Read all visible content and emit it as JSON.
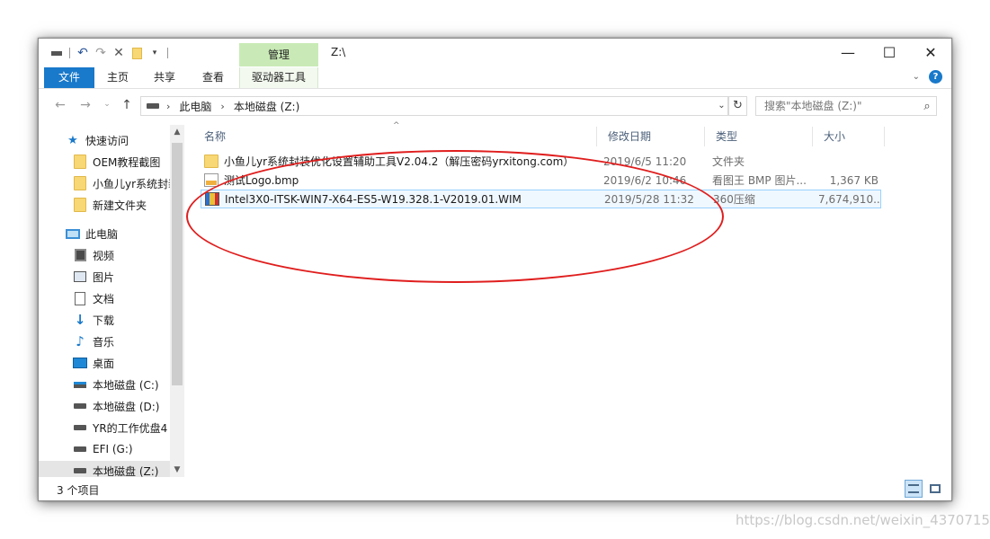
{
  "window": {
    "title": "Z:\\",
    "context_tab": "管理",
    "caption": {
      "minimize": "—",
      "maximize": "☐",
      "close": "✕"
    }
  },
  "ribbon": {
    "file": "文件",
    "home": "主页",
    "share": "共享",
    "view": "查看",
    "drive_tools": "驱动器工具",
    "help": "?"
  },
  "address": {
    "crumbs": [
      "此电脑",
      "本地磁盘 (Z:)"
    ],
    "search_placeholder": "搜索\"本地磁盘 (Z:)\""
  },
  "nav": {
    "quick_access": "快速访问",
    "pinned": [
      "OEM教程截图",
      "小鱼儿yr系统封装",
      "新建文件夹"
    ],
    "this_pc": "此电脑",
    "pc_items": [
      {
        "label": "视频",
        "icon": "video-icon"
      },
      {
        "label": "图片",
        "icon": "pictures-icon"
      },
      {
        "label": "文档",
        "icon": "document-icon"
      },
      {
        "label": "下载",
        "icon": "download-icon"
      },
      {
        "label": "音乐",
        "icon": "music-icon"
      },
      {
        "label": "桌面",
        "icon": "desktop-icon"
      },
      {
        "label": "本地磁盘 (C:)",
        "icon": "system-drive-icon"
      },
      {
        "label": "本地磁盘 (D:)",
        "icon": "drive-icon"
      },
      {
        "label": "YR的工作优盘4",
        "icon": "drive-icon"
      },
      {
        "label": "EFI (G:)",
        "icon": "drive-icon"
      },
      {
        "label": "本地磁盘 (Z:)",
        "icon": "drive-icon"
      }
    ]
  },
  "columns": {
    "name": "名称",
    "date": "修改日期",
    "type": "类型",
    "size": "大小"
  },
  "files": [
    {
      "name": "小鱼儿yr系统封装优化设置辅助工具V2.04.2（解压密码yrxitong.com）",
      "date": "2019/6/5 11:20",
      "type": "文件夹",
      "size": "",
      "icon": "folder-icon"
    },
    {
      "name": "测试Logo.bmp",
      "date": "2019/6/2 10:46",
      "type": "看图王 BMP 图片...",
      "size": "1,367 KB",
      "icon": "bmp-file-icon"
    },
    {
      "name": "Intel3X0-ITSK-WIN7-X64-ES5-W19.328.1-V2019.01.WIM",
      "date": "2019/5/28 11:32",
      "type": "360压缩",
      "size": "7,674,910...",
      "icon": "archive-file-icon"
    }
  ],
  "status": {
    "count": "3 个项目"
  },
  "watermark": "https://blog.csdn.net/weixin_43707156",
  "colors": {
    "accent": "#1979ca",
    "context_tab": "#c9eab6",
    "annotation": "#e01e1e",
    "selection": "#99d1ff"
  }
}
